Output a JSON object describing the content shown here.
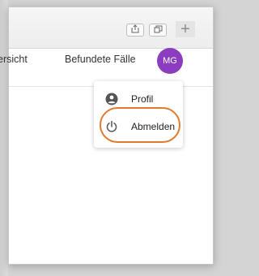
{
  "browser": {
    "newtab_symbol": "+"
  },
  "nav": {
    "overview_label": "ersicht",
    "cases_label": "Befundete Fälle"
  },
  "user": {
    "initials": "MG",
    "avatar_color": "#8c3cbf"
  },
  "menu": {
    "items": [
      {
        "label": "Profil",
        "icon": "account-circle-icon"
      },
      {
        "label": "Abmelden",
        "icon": "power-icon"
      }
    ]
  },
  "colors": {
    "highlight": "#e07a2e"
  }
}
